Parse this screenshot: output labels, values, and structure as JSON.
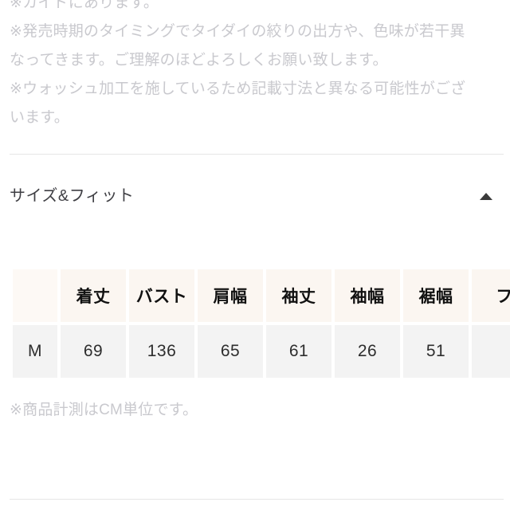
{
  "notes": {
    "lines": [
      "※カイドにあります。",
      "※発売時期のタイミングでタイダイの絞りの出方や、色味が若干異",
      "なってきます。ご理解のほどよろしくお願い致します。",
      "※ウォッシュ加工を施しているため記載寸法と異なる可能性がござ",
      "います。"
    ]
  },
  "section": {
    "title": "サイズ&フィット",
    "toggle_icon": "chevron-up-icon",
    "expanded": true
  },
  "size_table": {
    "headers": [
      "",
      "着丈",
      "バスト",
      "肩幅",
      "袖丈",
      "袖幅",
      "裾幅",
      "フ"
    ],
    "rows": [
      {
        "size": "M",
        "values": [
          "69",
          "136",
          "65",
          "61",
          "26",
          "51",
          ""
        ]
      }
    ]
  },
  "footnote": {
    "text": "※商品計測はCM単位です。"
  },
  "colors": {
    "header_cell_bg": "#fbf6f1",
    "data_cell_bg": "#f3f3f3",
    "muted_text": "#c9c9ce",
    "title_text": "#3f3f44",
    "divider": "#e6e6e6"
  }
}
